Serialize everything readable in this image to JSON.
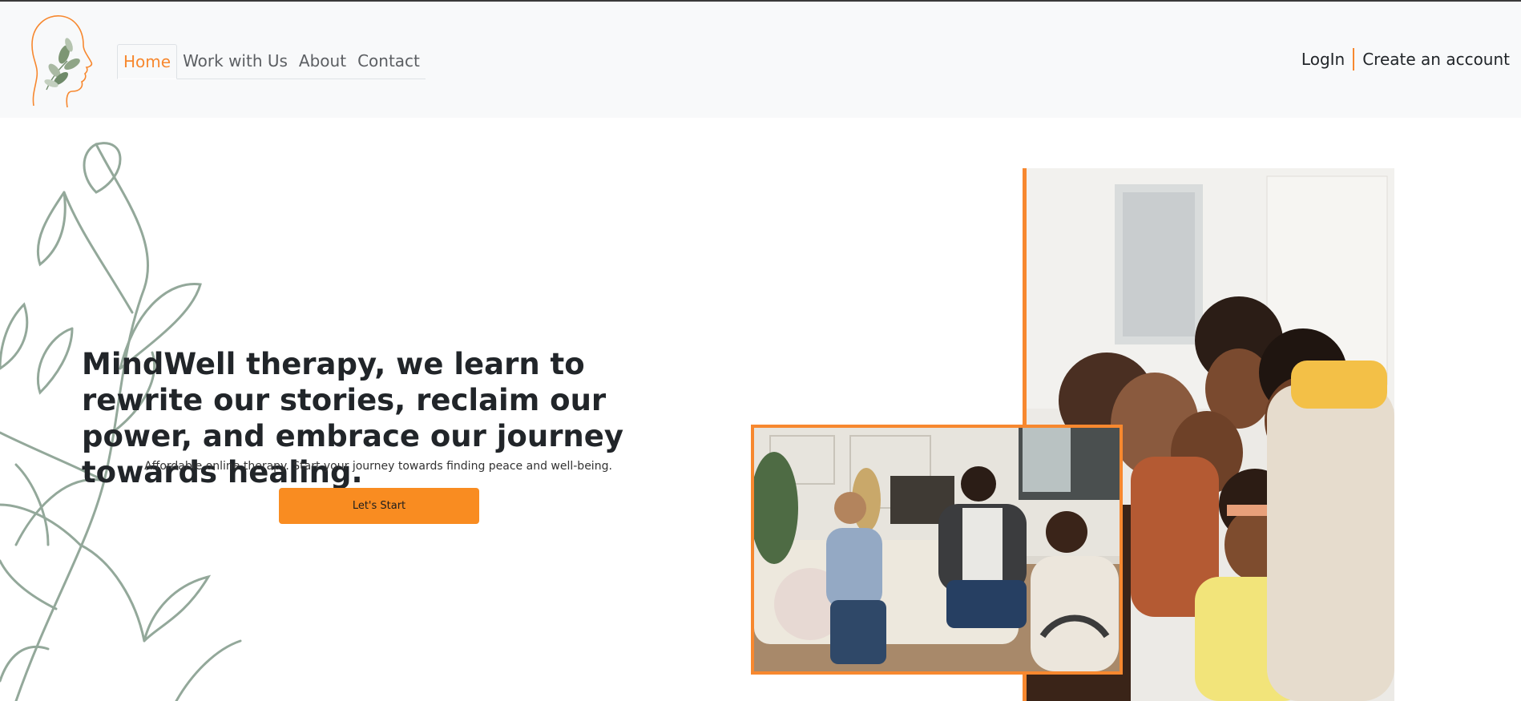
{
  "brand": {
    "logo_icon": "woman-profile-leaf-icon",
    "accent": "#f7882f"
  },
  "nav": {
    "items": [
      {
        "label": "Home",
        "active": true
      },
      {
        "label": "Work with Us",
        "active": false
      },
      {
        "label": "About",
        "active": false
      },
      {
        "label": "Contact",
        "active": false
      }
    ]
  },
  "auth": {
    "login_label": "LogIn",
    "signup_label": "Create an account"
  },
  "hero": {
    "title": "MindWell therapy, we learn to rewrite our stories, reclaim our power, and embrace our journey towards healing.",
    "subtitle": "Affordable online therapy. Start your journey towards finding peace and well-being.",
    "cta_label": "Let's Start"
  },
  "images": {
    "family_photo": "family-hug-photo",
    "session_photo": "therapy-session-photo",
    "decoration": "leaf-vine-illustration"
  }
}
